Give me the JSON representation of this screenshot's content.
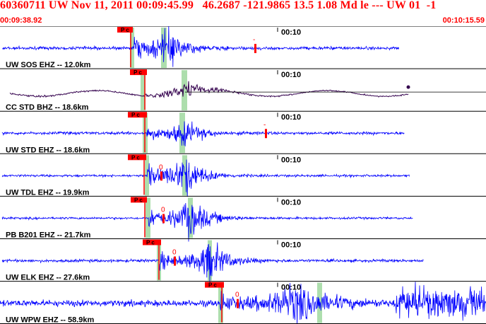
{
  "header": {
    "title": "60360711 UW Nov 11, 2011 00:09:45.99   46.2687 -121.9865 13.5 1.08 Md le --- UW 01  -1",
    "start_time": "00:09:38.92",
    "end_time": "00:10:15.59"
  },
  "time_mark": "00:10",
  "pick_label": "P c",
  "zero_label": "0",
  "colors": {
    "header_text": "#ff0000",
    "trace_blue": "#0000ff",
    "trace_dark": "#33004d",
    "pick_red": "#ff0000",
    "phase_green": "#9fd89f",
    "panel_border": "#000000"
  },
  "traces": [
    {
      "station": "UW SOS EHZ -- 12.0km",
      "marker": "-",
      "color": "blue"
    },
    {
      "station": "CC STD BHZ -- 18.6km",
      "marker": "",
      "color": "dark"
    },
    {
      "station": "UW STD EHZ -- 18.6km",
      "marker": "-",
      "color": "blue"
    },
    {
      "station": "UW TDL EHZ -- 19.9km",
      "marker": "0",
      "color": "blue"
    },
    {
      "station": "PB B201 EHZ -- 21.7km",
      "marker": "0",
      "color": "blue"
    },
    {
      "station": "UW ELK EHZ -- 27.6km",
      "marker": "0",
      "color": "blue"
    },
    {
      "station": "UW WPW EHZ -- 58.9km",
      "marker": "0",
      "color": "blue"
    }
  ]
}
